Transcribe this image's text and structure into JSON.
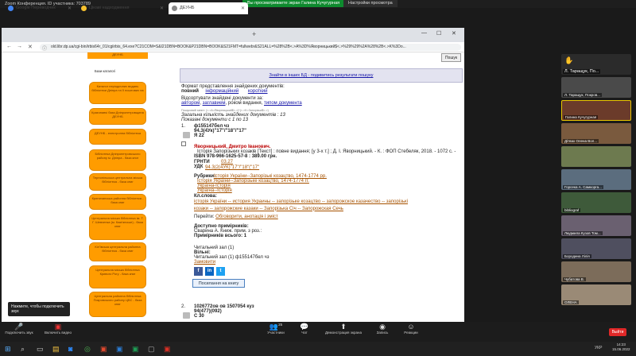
{
  "zoom": {
    "title": "Zoom Конференция. ID участника: 703789",
    "share_banner": "Вы просматриваете экран Галина Кучугурная",
    "share_settings": "Настройки просмотра",
    "controls": [
      {
        "label": "Подключить звук",
        "icon": "mic-icon"
      },
      {
        "label": "Включить видео",
        "icon": "video-icon"
      },
      {
        "label": "Участники",
        "icon": "participants-icon",
        "count": "25"
      },
      {
        "label": "Чат",
        "icon": "chat-icon"
      },
      {
        "label": "Демонстрация экрана",
        "icon": "share-screen-icon"
      },
      {
        "label": "Запись",
        "icon": "record-icon"
      },
      {
        "label": "Реакции",
        "icon": "reactions-icon"
      }
    ],
    "leave_label": "Выйти",
    "tooltip": "Нажмите, чтобы подключить звук",
    "gallery": [
      {
        "name": "Л. Таращук, По..."
      },
      {
        "name": "Л. Таращук, Покров..."
      },
      {
        "name": "Галина Кучугурная"
      },
      {
        "name": "Дітвах Олена Вол..."
      },
      {
        "name": ""
      },
      {
        "name": "Горсека А. Самкорга..."
      },
      {
        "name": "bibliograf"
      },
      {
        "name": "Людмила Кузов Том..."
      },
      {
        "name": "Бородина Лілія"
      },
      {
        "name": "Чубатова В."
      },
      {
        "name": "ОЛЕНА"
      }
    ]
  },
  "browser": {
    "tabs": [
      {
        "label": "Google Переводчик",
        "color": "#4285f4"
      },
      {
        "label": "Цікаві надходження",
        "color": "#f7c22f"
      },
      {
        "label": "ДЕУНБ",
        "color": "#888888"
      }
    ],
    "url": "old.libr.dp.ua/cgi-bin/irbis64r_01/cgiirbis_64.exe?C21COM=S&I21DBN=BOOK&P21DBN=BOOK&S21FMT=fullwebr&S21ALL=%28%2B<.>A%3D%Яворницький$<.>%29%29%2A%28%2B<.>K%3Do..."
  },
  "sidebar": {
    "top": "ДЕУНБ",
    "items": [
      "Бази каталогі",
      "Каталог періодичних видань бібліотеки Дніпра та її поштових на",
      "Краєзнавчі бази Дніпропетровщина ДЕУНБ",
      "ДЕУНБ - електронна бібліотека",
      "Бібліотека Дніпропетровського району м. Дніпра - база книг",
      "Тернопільська центральна міська бібліотека - база книг",
      "Криничанська районна бібліотека - база книг",
      "Центральна міська бібліотека ім. Т. Г. Шевченка (м. Кам'янське) - база книг",
      "Кіл'ївська центральна районна бібліотека - база книг",
      "Центральна міська бібліотека Кривого Рогу - база книг",
      "Центральна районна бібліотека Покровського району ЦБС - база книг"
    ]
  },
  "results": {
    "search_btn": "Пошук",
    "banner_link": "Знайти в інших БД - подивитись результати пошуку",
    "format_label": "Формат представлення знайдених документів:",
    "format_opts": [
      "повний",
      "інформаційний",
      "короткий"
    ],
    "sort_label": "Відсортувати знайдені документи за:",
    "sort_opts": [
      "автором",
      "заглавием",
      "роком видання",
      "типом документа"
    ],
    "search_query": "Пошуковий запит: (<.>A=Яворницький$<.>)*(<.>K=Запорізькі$<.>)",
    "total": "Загальна кількість знайдених документів : 13",
    "shown": "Показані документи с 1 по 13",
    "doc1": {
      "num": "1.",
      "code": "ф155147бел чз",
      "shelf": "94.3(4Ук)\"17\"/\"18\"/\"17\"",
      "sign": "Я 22",
      "author": "Яворницький, Дмитро Іванович.",
      "title": "Історія Запорізьких козаків [Текст] : повне видання; [у 3-х т.] ; Д. І. Яворницький. - К. : ФОП Стебеляк, 2018. - 1072 с. -",
      "isbn": "ISBN 978-966-1625-57-8 : 389.00 грн.",
      "grnti_label": "ГРНТИ",
      "grnti": "03.27",
      "udk_label": "УДК",
      "udk": "94.3(2(4УК)\"17\"/\"18\"(\"17\"",
      "rubrics_label": "Рубрики:",
      "rubrics": [
        "Історія України--Запорізькі козацтво, 1474-1774 рр.",
        "Історія України--Запорізьке козацтво, 1474-1774 гг.",
        "Україна-Історія",
        "Україна--Історія"
      ],
      "keywords_label": "Кл.слова:",
      "keywords": "історія України -- история Украины -- запорізьке козацтво -- запорожское казачество -- запорізькі козаки -- запорожские казаки -- Запорізька Січ -- Запорожская Сечь",
      "goto_label": "Перейти:",
      "goto": "Обговорити, анотація і зміст",
      "holdings_label": "Доступно примірників:",
      "holdings1": "Сварина А. Книж. прим. з роз.:",
      "holdings2": "Примірників всього: 1",
      "reading1": "Читальний зал (1)",
      "free": "Вільні:",
      "reading2": "Читальний зал (1) ф155147бел чз",
      "qr": "Замовити",
      "order_btn": "Посилання на книгу"
    },
    "doc2": {
      "num": "2.",
      "code": "1026772ов ов 1507054 куз",
      "shelf": "94(477)(092)",
      "sign": "С 30"
    }
  },
  "taskbar": {
    "time": "14:23",
    "date": "15.06.2022",
    "lang": "УКР"
  }
}
